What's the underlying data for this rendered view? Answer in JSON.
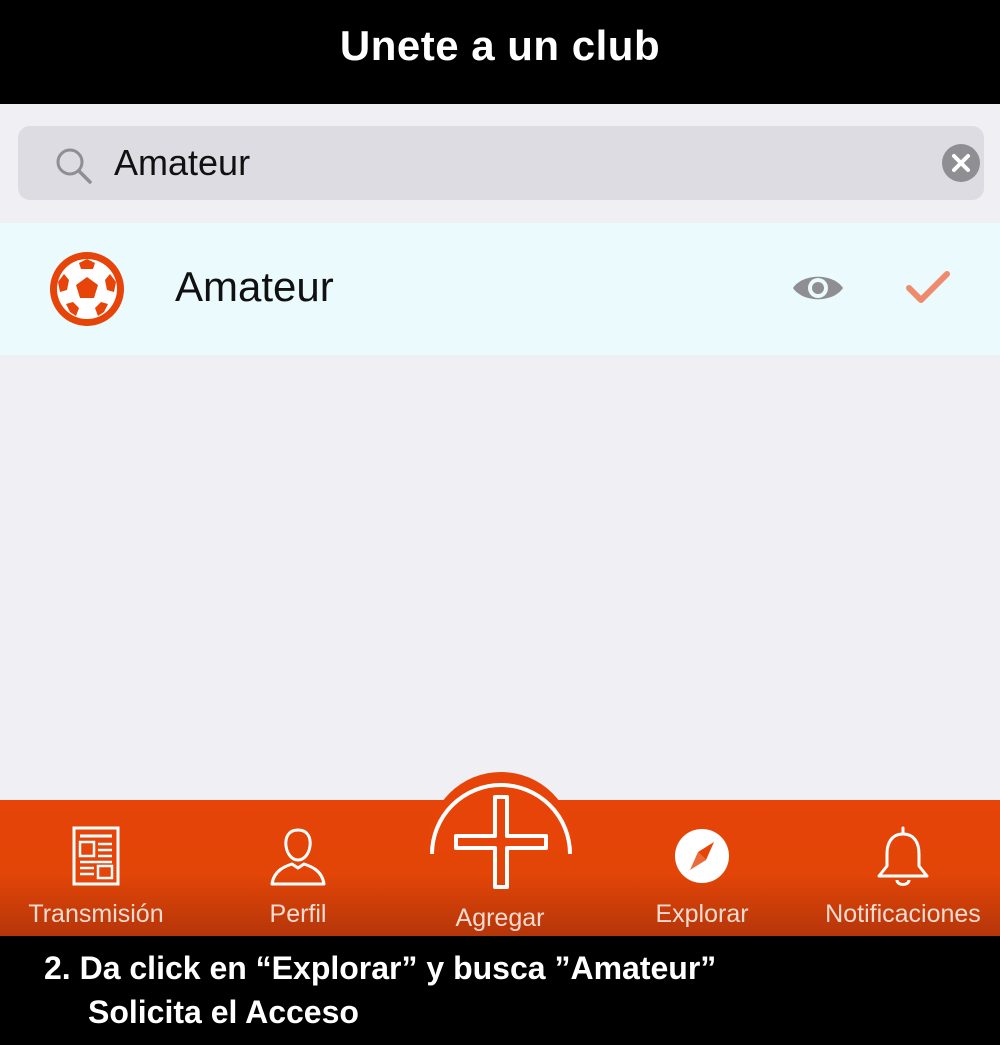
{
  "header": {
    "title": "Unete a un club"
  },
  "search": {
    "value": "Amateur",
    "icon": "search-icon",
    "clear_icon": "clear-icon"
  },
  "results": [
    {
      "name": "Amateur",
      "icon": "soccer-ball-icon",
      "actions": [
        "eye-icon",
        "check-icon"
      ]
    }
  ],
  "tabbar": {
    "items": [
      {
        "label": "Transmisión",
        "icon": "newspaper-icon"
      },
      {
        "label": "Perfil",
        "icon": "person-icon"
      },
      {
        "label": "Agregar",
        "icon": "plus-icon"
      },
      {
        "label": "Explorar",
        "icon": "compass-icon"
      },
      {
        "label": "Notificaciones",
        "icon": "bell-icon"
      }
    ]
  },
  "caption": {
    "line1": "2. Da click en “Explorar” y busca ”Amateur”",
    "line2": "Solicita el Acceso"
  },
  "colors": {
    "accent": "#e64408",
    "header_bg": "#000000",
    "row_bg": "#eafafd",
    "page_bg": "#efeff4",
    "check": "#ef8a6c",
    "eye": "#8e8e93"
  }
}
